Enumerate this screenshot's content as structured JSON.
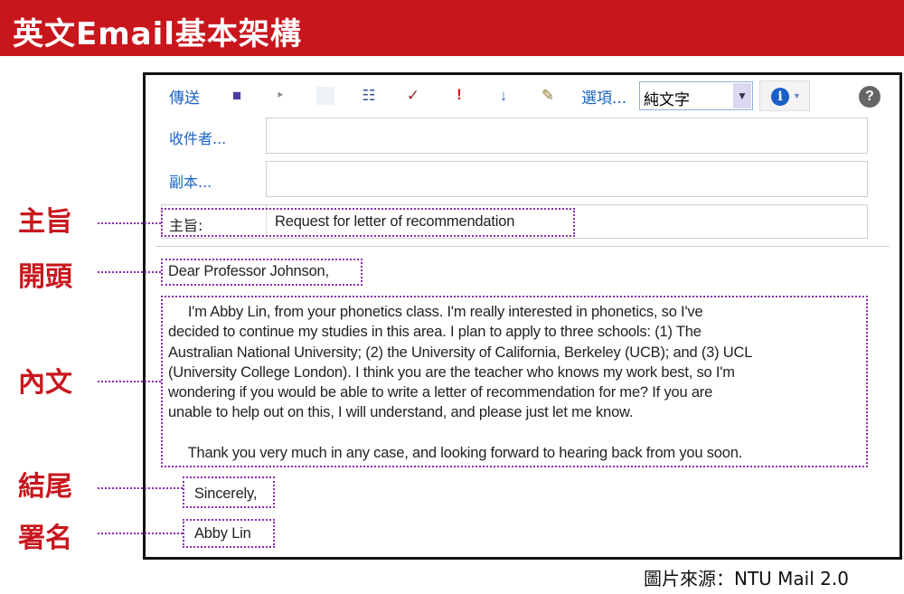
{
  "header": {
    "title": "英文Email基本架構"
  },
  "toolbar": {
    "send_label": "傳送",
    "options_label": "選項...",
    "format_select": "純文字",
    "icons": [
      "save-icon",
      "attach-icon",
      "image-icon",
      "address-book-icon",
      "spell-check-icon",
      "high-importance-icon",
      "low-importance-icon",
      "signature-icon",
      "info-icon",
      "help-icon"
    ]
  },
  "fields": {
    "to_label": "收件者...",
    "to_value": "",
    "cc_label": "副本...",
    "cc_value": "",
    "subject_label": "主旨:",
    "subject_value": "Request for letter of recommendation"
  },
  "body": {
    "greeting": "Dear Professor Johnson,",
    "paragraph_lines": [
      "     I'm Abby Lin, from your phonetics class. I'm really interested in phonetics, so I've",
      "decided to continue my studies in this area. I plan to apply to three schools: (1) The",
      "Australian National University; (2) the University of California, Berkeley (UCB); and (3) UCL",
      "(University College London). I think you are the teacher who knows my work best, so I'm",
      "wondering if you would be able to write a letter of recommendation for me? If you are",
      "unable to help out on this, I will understand, and please just let me know.",
      "",
      "     Thank you very much in any case, and looking forward to hearing back from you soon."
    ],
    "closing": "Sincerely,",
    "signature": "Abby Lin"
  },
  "annotations": {
    "subject": "主旨",
    "opening": "開頭",
    "body": "內文",
    "closing": "結尾",
    "signature": "署名"
  },
  "caption": "圖片來源：NTU Mail 2.0",
  "colors": {
    "brand_red": "#c8161d",
    "annotation_purple": "#8a2bb5",
    "link_blue": "#1a63c7"
  }
}
